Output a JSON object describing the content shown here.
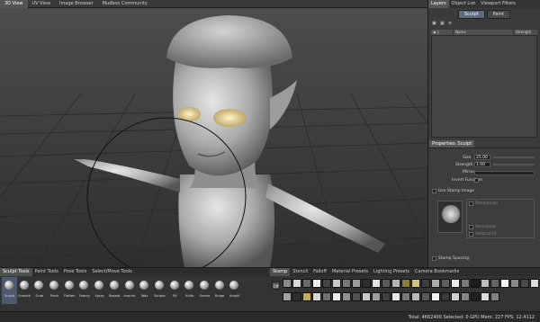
{
  "top_tabs": [
    "3D View",
    "UV View",
    "Image Browser",
    "Mudbox Community"
  ],
  "right_tabs": [
    "Layers",
    "Object List",
    "Viewport Filters"
  ],
  "layer_subtabs": [
    "Sculpt",
    "Paint"
  ],
  "layers_columns": [
    "",
    "Name",
    "Strength"
  ],
  "layer_icons": [
    "new-layer-icon",
    "duplicate-icon",
    "options-icon"
  ],
  "properties_title": "Properties: Sculpt",
  "properties": {
    "size_label": "Size",
    "size_value": "25.00",
    "strength_label": "Strength",
    "strength_value": "1.00",
    "mirror_label": "Mirror",
    "invert_label": "Invert Function",
    "stamp_image_label": "Use Stamp Image",
    "randomize_label": "Randomize",
    "horizontal_label": "Horizontal",
    "vertical_label": "Vertical Fli",
    "stamp_spacing_label": "Stamp Spacing"
  },
  "shelf_tabs": [
    "Sculpt Tools",
    "Paint Tools",
    "Pose Tools",
    "Select/Move Tools"
  ],
  "sculpt_tools": [
    "Sculpt",
    "Smooth",
    "Grab",
    "Pinch",
    "Flatten",
    "Foamy",
    "Spray",
    "Repeat",
    "Imprint",
    "Wax",
    "Scrape",
    "Fill",
    "Knife",
    "Smear",
    "Bulge",
    "Amplif"
  ],
  "stamp_tabs": [
    "Stamp",
    "Stencil",
    "Falloff",
    "Material Presets",
    "Lighting Presets",
    "Camera Bookmarks"
  ],
  "stamp_off_label": "Off",
  "stamp_colors": [
    "#8a8a8a",
    "#d8d8d8",
    "#6b6b6b",
    "#f0f0f0",
    "#444",
    "#c9c9c9",
    "#777",
    "#9b9b9b",
    "#2e2e2e",
    "#e3e3e3",
    "#5a5a5a",
    "#b4b4b4",
    "#8c7a3a",
    "#d2c27a",
    "#3c3c3c",
    "#aaa",
    "#5d5d5d",
    "#ececec",
    "#7a7a7a",
    "#1d1d1d",
    "#bdbdbd",
    "#666",
    "#f5f5f5",
    "#888",
    "#4a4a4a",
    "#dcdcdc",
    "#a1a1a1",
    "#303030",
    "#c5a85a",
    "#d8d8d8",
    "#6f6f6f",
    "#ededed",
    "#8f8f8f",
    "#525252",
    "#cacaca",
    "#9e9e9e",
    "#404040",
    "#e8e8e8",
    "#767676",
    "#b9b9b9",
    "#5a5a5a",
    "#f2f2f2",
    "#3a3a3a",
    "#cfcfcf",
    "#868686",
    "#222",
    "#dddddd",
    "#7f7f7f"
  ],
  "status_text": "Total: 4662400   Selected: 0   GPU Mem: 227   FPS: 12.4112"
}
